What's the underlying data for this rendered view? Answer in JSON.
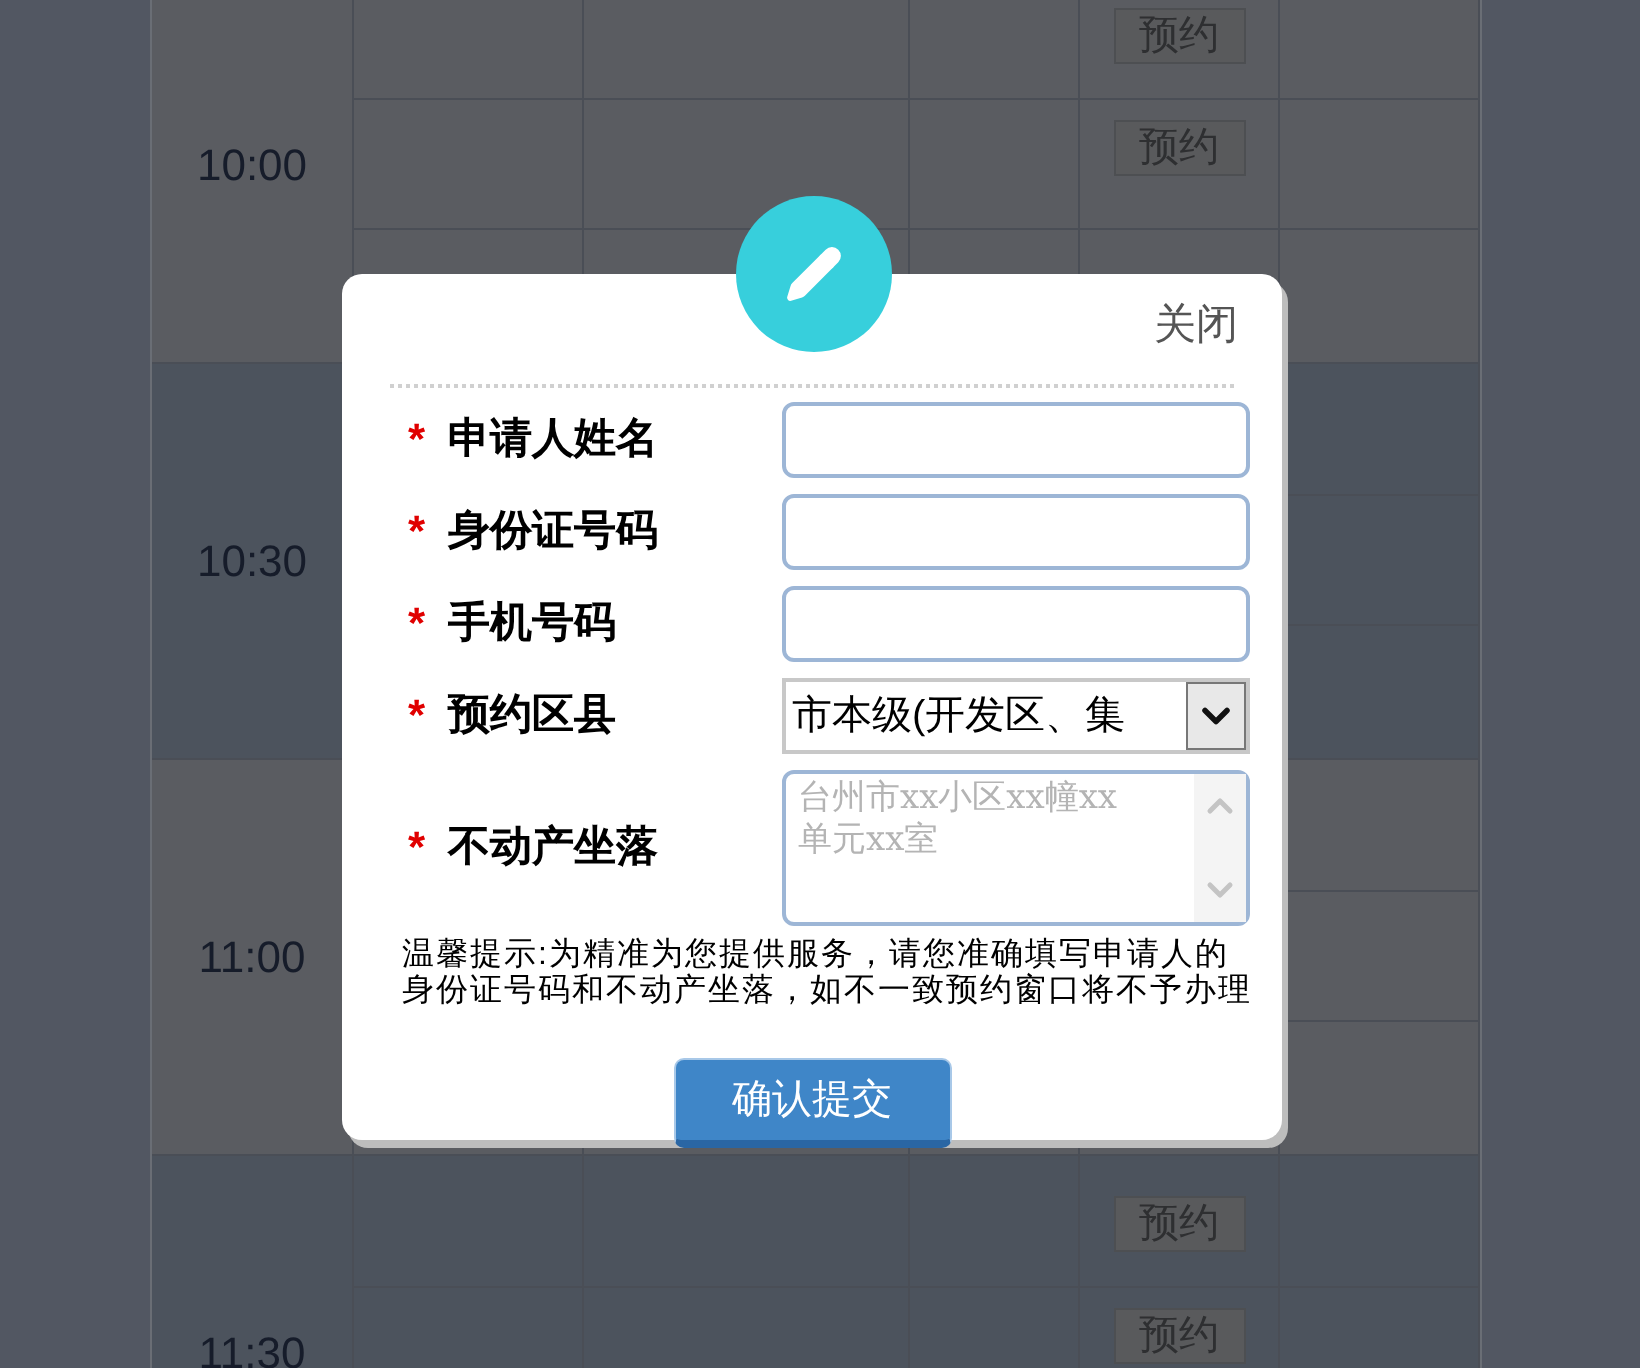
{
  "schedule": {
    "slots": [
      {
        "time": "10:00",
        "buttons": [
          "预约",
          "预约"
        ]
      },
      {
        "time": "10:30"
      },
      {
        "time": "11:00"
      },
      {
        "time": "11:30",
        "buttons": [
          "预约",
          "预约"
        ]
      }
    ]
  },
  "dialog": {
    "close": "关闭",
    "fields": [
      {
        "kind": "text",
        "mark": "*",
        "label": "申请人姓名"
      },
      {
        "kind": "text",
        "mark": "*",
        "label": "身份证号码"
      },
      {
        "kind": "text",
        "mark": "*",
        "label": "手机号码"
      },
      {
        "kind": "select",
        "mark": "*",
        "label": "预约区县",
        "value": "市本级(开发区、集"
      },
      {
        "kind": "textarea",
        "mark": "*",
        "label": "不动产坐落",
        "placeholder": "台州市xx小区xx幢xx单元xx室"
      }
    ],
    "notice": "温馨提示:为精准为您提供服务，请您准确填写申请人的身份证号码和不动产坐落，如不一致预约窗口将不予办理",
    "submit": "确认提交"
  }
}
